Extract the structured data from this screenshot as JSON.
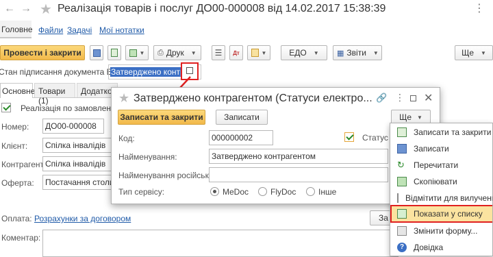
{
  "window": {
    "title": "Реалізація товарів і послуг ДО00-000008 від 14.02.2017 15:38:39",
    "nav_tabs": [
      "Головне",
      "Файли",
      "Задачі",
      "Мої нотатки"
    ]
  },
  "toolbar": {
    "post_close": "Провести і закрити",
    "print": "Друк",
    "edo": "ЕДО",
    "reports": "Звіти",
    "more": "Ще"
  },
  "edo_state": {
    "label": "Стан підписання документа ЕДО:",
    "value": "Затверджено контраге"
  },
  "doc_tabs": [
    "Основне",
    "Товари (1)",
    "Додатков"
  ],
  "form": {
    "checkbox_label": "Реалізація по замовленню",
    "number_label": "Номер:",
    "number_value": "ДО00-000008",
    "client_label": "Клієнт:",
    "client_value": "Спілка інвалідів",
    "counterparty_label": "Контрагент:",
    "counterparty_value": "Спілка інвалідів",
    "offer_label": "Оферта:",
    "offer_value": "Постачання столиків",
    "payment_label": "Оплата:",
    "payment_link": "Розрахунки за договором",
    "comment_label": "Коментар:",
    "partial_button": "За"
  },
  "dialog": {
    "title": "Затверджено контрагентом (Статуси електро...",
    "save_close": "Записати та закрити",
    "save": "Записати",
    "more": "Ще",
    "code_label": "Код:",
    "code_value": "000000002",
    "name_label": "Найменування:",
    "name_value": "Затверджено контрагентом",
    "name_ru_label": "Найменування російською:",
    "name_ru_value": "",
    "status_label": "Статус у",
    "service_label": "Тип сервісу:",
    "service_options": [
      "MeDoc",
      "FlyDoc",
      "Інше"
    ],
    "service_selected": "MeDoc"
  },
  "menu": {
    "items": [
      "Записати та закрити",
      "Записати",
      "Перечитати",
      "Скопіювати",
      "Відмітити для вилучення / ",
      "Показати у списку",
      "Змінити форму...",
      "Довідка"
    ],
    "highlighted": "Показати у списку"
  },
  "colors": {
    "accent_yellow": "#f2b94a",
    "link_blue": "#1f5aa8",
    "highlight_red": "#e02020",
    "menu_highlight": "#fbe3a0"
  }
}
